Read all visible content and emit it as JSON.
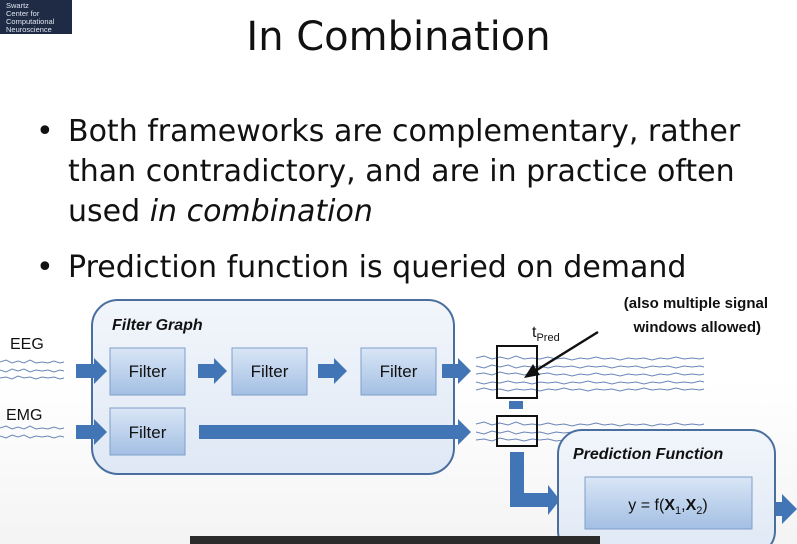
{
  "logo": {
    "lines": [
      "Swartz",
      "Center for",
      "Computational",
      "Neuroscience"
    ]
  },
  "slide": {
    "title": "In Combination",
    "bullet1_a": "Both frameworks are complementary, rather than contradictory, and are in practice often used ",
    "bullet1_em": "in combination",
    "bullet2": "Prediction function is queried on demand"
  },
  "diagram": {
    "filter_graph_label": "Filter Graph",
    "eeg_label": "EEG",
    "emg_label": "EMG",
    "filter_label": "Filter",
    "tpred_main": "t",
    "tpred_sub": "Pred",
    "note_line1": "(also multiple signal",
    "note_line2": "windows allowed)",
    "prediction_label": "Prediction Function",
    "formula": {
      "y": "y = f(",
      "x1": "X",
      "s1": "1",
      "comma": ",",
      "x2": "X",
      "s2": "2",
      "close": ")"
    }
  },
  "colors": {
    "box_fill": "#e7eef8",
    "box_stroke": "#4a6f9e",
    "arrow": "#4275b6",
    "filter_fill": "#a9c4e6"
  }
}
